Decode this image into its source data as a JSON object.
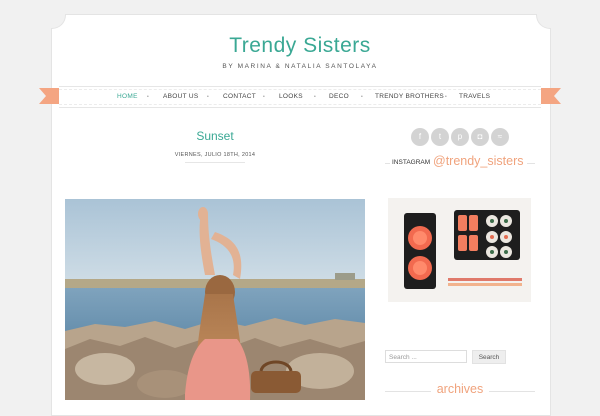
{
  "site": {
    "title": "Trendy Sisters",
    "tagline": "BY MARINA & NATALIA SANTOLAYA",
    "accent_color": "#3aa894",
    "secondary_color": "#f0a37d"
  },
  "nav": {
    "items": [
      {
        "label": "HOME",
        "active": true
      },
      {
        "label": "ABOUT US"
      },
      {
        "label": "CONTACT"
      },
      {
        "label": "LOOKS"
      },
      {
        "label": "DECO"
      },
      {
        "label": "TRENDY BROTHERS"
      },
      {
        "label": "TRAVELS"
      }
    ],
    "separator": "•"
  },
  "post": {
    "title": "Sunset",
    "date": "VIERNES, JULIO 18TH, 2014"
  },
  "sidebar": {
    "social_icons": [
      "facebook-icon",
      "twitter-icon",
      "pinterest-icon",
      "instagram-icon",
      "rss-icon"
    ],
    "instagram_label": "INSTAGRAM",
    "instagram_handle": "@trendy_sisters",
    "search_placeholder": "Search ...",
    "search_button": "Search",
    "archives_heading": "archives"
  }
}
